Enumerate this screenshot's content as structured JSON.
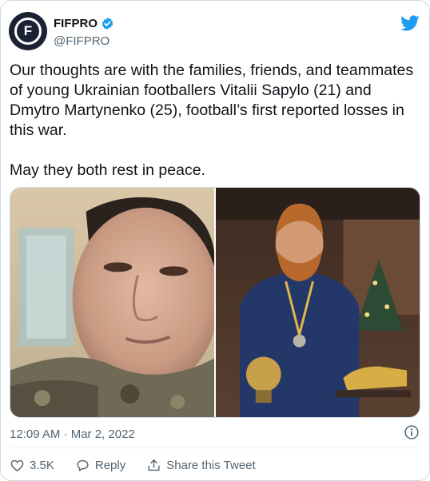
{
  "account": {
    "display_name": "FIFPRO",
    "handle": "@FIFPRO",
    "avatar_letter": "F"
  },
  "tweet": {
    "paragraph1": "Our thoughts are with the families, friends, and teammates of young Ukrainian footballers Vitalii Sapylo (21) and Dmytro Martynenko (25), football’s first reported losses in this war.",
    "paragraph2": "May they both rest in peace.",
    "timestamp": "12:09 AM · Mar 2, 2022"
  },
  "actions": {
    "likes": "3.5K",
    "reply_label": "Reply",
    "share_label": "Share this Tweet"
  },
  "colors": {
    "brand_blue": "#1d9bf0",
    "text": "#0f1419",
    "secondary_text": "#536471"
  },
  "icons": [
    "verified-badge-icon",
    "twitter-bird-icon",
    "info-icon",
    "heart-icon",
    "reply-icon",
    "share-icon"
  ]
}
